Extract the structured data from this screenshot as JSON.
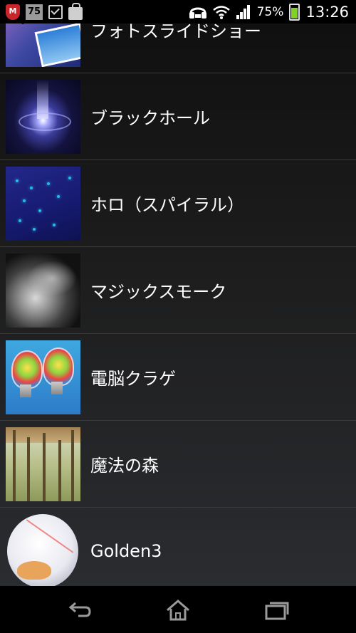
{
  "status_bar": {
    "security_badge": "M",
    "notification_count": "75",
    "battery_percent": "75%",
    "time": "13:26",
    "icons": [
      "security-shield-icon",
      "notification-count-icon",
      "checkbox-icon",
      "shopping-bag-icon",
      "headset-icon",
      "wifi-icon",
      "signal-icon",
      "battery-icon"
    ]
  },
  "list": {
    "items": [
      {
        "label": "フォトスライドショー",
        "thumbnail": "photo-slideshow-thumbnail"
      },
      {
        "label": "ブラックホール",
        "thumbnail": "black-hole-thumbnail"
      },
      {
        "label": "ホロ（スパイラル）",
        "thumbnail": "holo-spiral-thumbnail"
      },
      {
        "label": "マジックスモーク",
        "thumbnail": "magic-smoke-thumbnail"
      },
      {
        "label": "電脳クラゲ",
        "thumbnail": "cyber-jellyfish-thumbnail"
      },
      {
        "label": "魔法の森",
        "thumbnail": "magic-forest-thumbnail"
      },
      {
        "label": "Golden3",
        "thumbnail": "golden3-thumbnail"
      }
    ]
  },
  "nav_bar": {
    "buttons": [
      "back-icon",
      "home-icon",
      "recent-apps-icon"
    ]
  },
  "colors": {
    "battery_fill": "#7fd321",
    "security_red": "#c8262a",
    "divider": "#3a3a3a"
  }
}
